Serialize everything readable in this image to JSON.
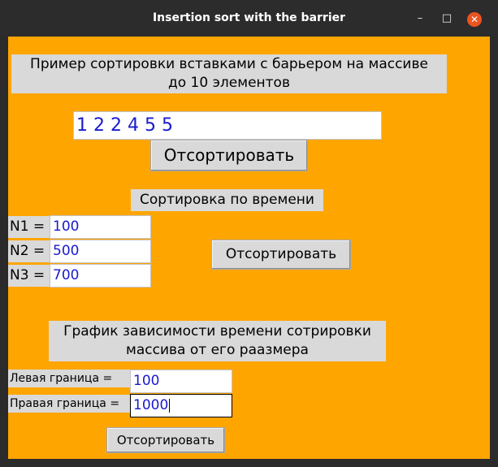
{
  "window": {
    "title": "Insertion sort with the barrier",
    "minimize_glyph": "–",
    "maximize_glyph": "□",
    "close_glyph": "✕"
  },
  "section1": {
    "heading_line1": "Пример сортировки вставками с барьером на массиве",
    "heading_line2": "до 10 элементов",
    "array_value": "1 2 2 4 5 5",
    "sort_button": "Отсортировать"
  },
  "section2": {
    "heading": "Сортировка по времени",
    "n1_label": "N1 =",
    "n1_value": "100",
    "n2_label": "N2 =",
    "n2_value": "500",
    "n3_label": "N3 =",
    "n3_value": "700",
    "sort_button": "Отсортировать"
  },
  "section3": {
    "heading_line1": "График зависимости времени сотрировки",
    "heading_line2": "массива от его раазмера",
    "left_label": "Левая граница =",
    "left_value": "100",
    "right_label": "Правая граница =",
    "right_value": "1000",
    "sort_button": "Отсортировать"
  },
  "colors": {
    "background": "#ffa500",
    "label_bg": "#d9d9d9",
    "entry_text": "#1a1acd",
    "close_button": "#e95420"
  }
}
